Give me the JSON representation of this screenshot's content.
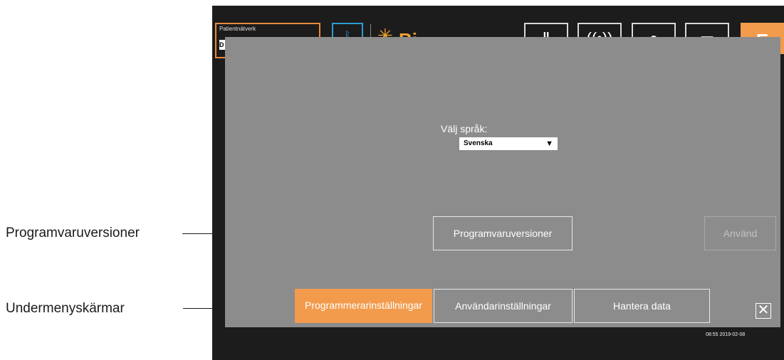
{
  "callouts": {
    "versions_label": "Programvaruversioner",
    "submenu_label": "Undermenyskärmar"
  },
  "header": {
    "patient_network_title": "Patientnätverk",
    "patient_field_value": "D",
    "bluetooth_icon": "bluetooth-icon",
    "brand_star_icon": "brand-star-icon",
    "brand_text": "Bi",
    "icons": [
      "lungs-icon",
      "signal-icon",
      "person-icon",
      "document-icon"
    ],
    "orange_tab_text": "E",
    "colors": {
      "accent": "#f29b4c",
      "bluetooth": "#2e9bd6",
      "brand": "#f2a531"
    }
  },
  "panel": {
    "language_label": "Välj språk:",
    "language_selected": "Svenska",
    "versions_button": "Programvaruversioner",
    "apply_button": "Använd",
    "tabs": [
      {
        "label": "Programmerarinställningar",
        "active": true
      },
      {
        "label": "Användarinställningar",
        "active": false
      },
      {
        "label": "Hantera data",
        "active": false
      }
    ],
    "close_symbol": "✕",
    "timestamp": "08:55 2019-02-08",
    "colors": {
      "panel_bg": "#8c8c8c",
      "active_tab": "#f29b4c"
    }
  }
}
